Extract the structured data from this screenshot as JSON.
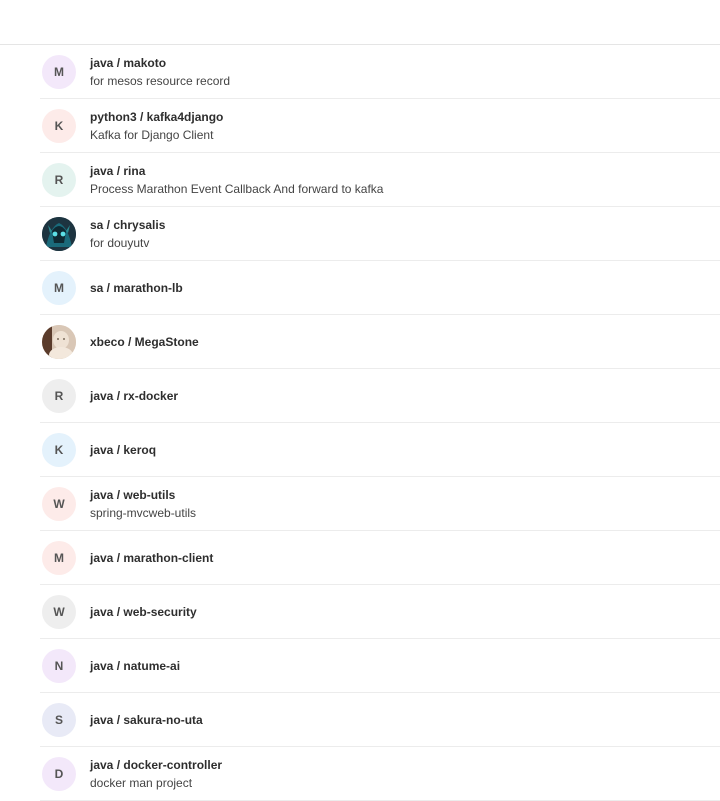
{
  "projects": [
    {
      "letter": "M",
      "namespace": "java",
      "name": "makoto",
      "full": "java / makoto",
      "desc": "for mesos resource record",
      "color": "#f3e8fa",
      "avatar": "letter"
    },
    {
      "letter": "K",
      "namespace": "python3",
      "name": "kafka4django",
      "full": "python3 / kafka4django",
      "desc": "Kafka for Django Client",
      "color": "#fdebe9",
      "avatar": "letter"
    },
    {
      "letter": "R",
      "namespace": "java",
      "name": "rina",
      "full": "java / rina",
      "desc": "Process Marathon Event Callback And forward to kafka",
      "color": "#e4f3ef",
      "avatar": "letter"
    },
    {
      "letter": "",
      "namespace": "sa",
      "name": "chrysalis",
      "full": "sa / chrysalis",
      "desc": "for douyutv",
      "color": "#1d3440",
      "avatar": "image-dark"
    },
    {
      "letter": "M",
      "namespace": "sa",
      "name": "marathon-lb",
      "full": "sa / marathon-lb",
      "desc": "",
      "color": "#e4f2fc",
      "avatar": "letter"
    },
    {
      "letter": "",
      "namespace": "xbeco",
      "name": "MegaStone",
      "full": "xbeco / MegaStone",
      "desc": "",
      "color": "#d9c7b6",
      "avatar": "image-light"
    },
    {
      "letter": "R",
      "namespace": "java",
      "name": "rx-docker",
      "full": "java / rx-docker",
      "desc": "",
      "color": "#eeeeee",
      "avatar": "letter"
    },
    {
      "letter": "K",
      "namespace": "java",
      "name": "keroq",
      "full": "java / keroq",
      "desc": "",
      "color": "#e4f2fc",
      "avatar": "letter"
    },
    {
      "letter": "W",
      "namespace": "java",
      "name": "web-utils",
      "full": "java / web-utils",
      "desc": "spring-mvcweb-utils",
      "color": "#fdebe9",
      "avatar": "letter"
    },
    {
      "letter": "M",
      "namespace": "java",
      "name": "marathon-client",
      "full": "java / marathon-client",
      "desc": "",
      "color": "#fdebe9",
      "avatar": "letter"
    },
    {
      "letter": "W",
      "namespace": "java",
      "name": "web-security",
      "full": "java / web-security",
      "desc": "",
      "color": "#eeeeee",
      "avatar": "letter"
    },
    {
      "letter": "N",
      "namespace": "java",
      "name": "natume-ai",
      "full": "java / natume-ai",
      "desc": "",
      "color": "#f3e8fa",
      "avatar": "letter"
    },
    {
      "letter": "S",
      "namespace": "java",
      "name": "sakura-no-uta",
      "full": "java / sakura-no-uta",
      "desc": "",
      "color": "#e8eaf6",
      "avatar": "letter"
    },
    {
      "letter": "D",
      "namespace": "java",
      "name": "docker-controller",
      "full": "java / docker-controller",
      "desc": "docker man project",
      "color": "#f3e8fa",
      "avatar": "letter"
    }
  ]
}
